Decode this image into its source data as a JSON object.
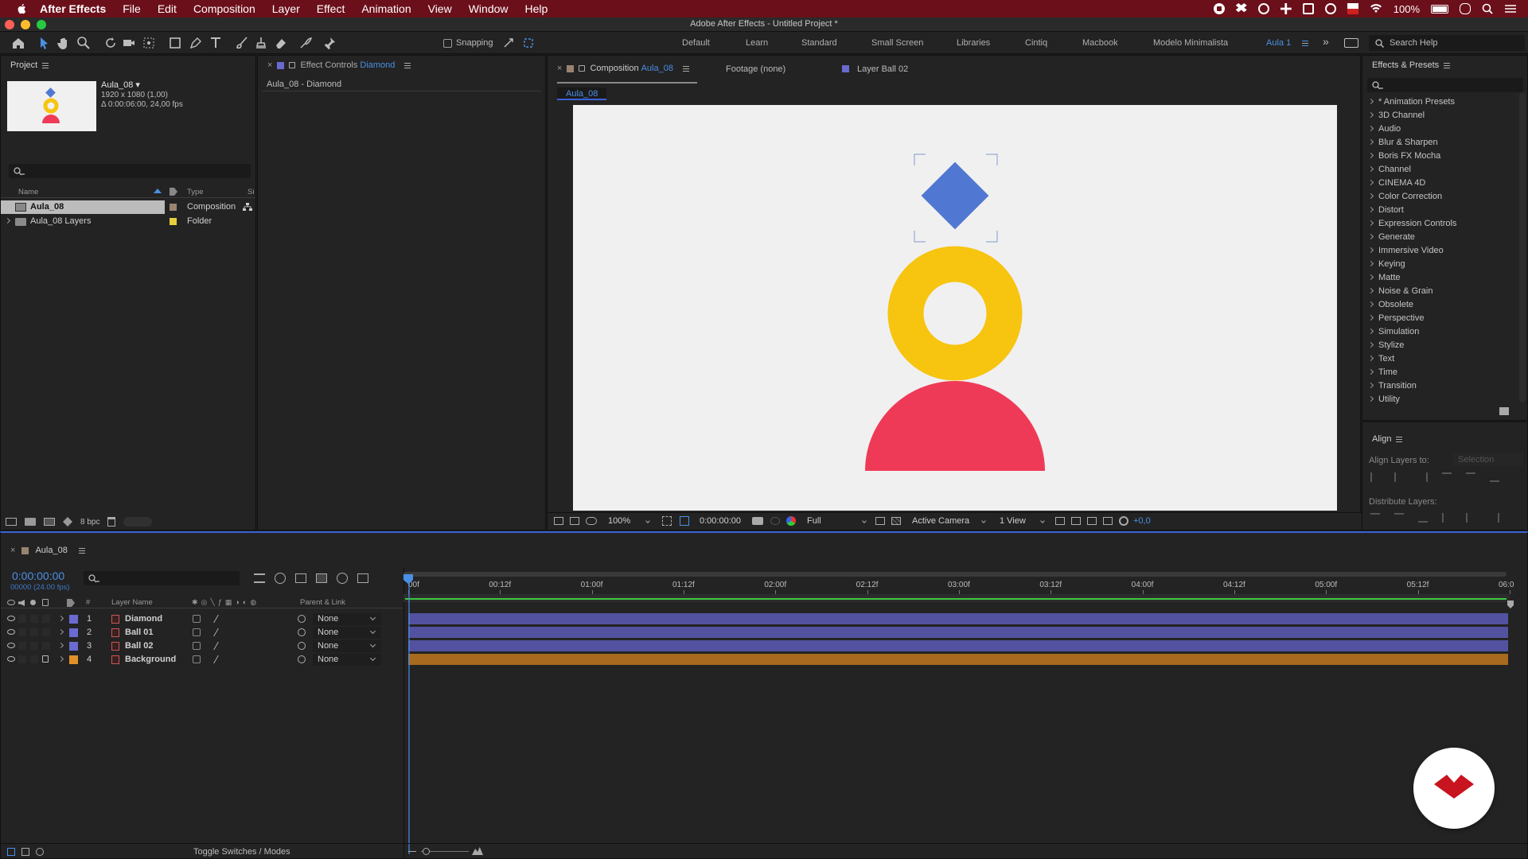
{
  "menubar": {
    "app_name": "After Effects",
    "items": [
      "File",
      "Edit",
      "Composition",
      "Layer",
      "Effect",
      "Animation",
      "View",
      "Window",
      "Help"
    ],
    "battery": "100%"
  },
  "window": {
    "title": "Adobe After Effects - Untitled Project *"
  },
  "toolbar": {
    "snapping_label": "Snapping",
    "workspaces": [
      "Default",
      "Learn",
      "Standard",
      "Small Screen",
      "Libraries",
      "Cintiq",
      "Macbook",
      "Modelo Minimalista",
      "Aula 1"
    ],
    "active_workspace": "Aula 1",
    "search_placeholder": "Search Help"
  },
  "project": {
    "tab": "Project",
    "selected_name": "Aula_08 ▾",
    "selected_dims": "1920 x 1080 (1,00)",
    "selected_duration": "Δ 0:00:06:00, 24,00 fps",
    "columns": [
      "Name",
      "Type",
      "Si"
    ],
    "items": [
      {
        "name": "Aula_08",
        "type": "Composition",
        "label_color": "#9a8470"
      },
      {
        "name": "Aula_08 Layers",
        "type": "Folder",
        "label_color": "#e6cf3c"
      }
    ],
    "bpc": "8 bpc"
  },
  "effect_controls": {
    "tab_prefix": "Effect Controls",
    "tab_layer": "Diamond",
    "subtitle": "Aula_08 - Diamond"
  },
  "composition": {
    "tab_prefix": "Composition",
    "tab_name": "Aula_08",
    "footage_tab": "Footage (none)",
    "layer_tab": "Layer Ball 02",
    "subtab": "Aula_08",
    "footer": {
      "zoom": "100%",
      "timecode": "0:00:00:00",
      "resolution": "Full",
      "camera": "Active Camera",
      "view": "1 View",
      "exposure": "+0,0"
    },
    "colors": {
      "diamond": "#5078d2",
      "ring": "#f7c40f",
      "semicircle": "#ef3a57",
      "bg": "#f0f0f0"
    }
  },
  "effects": {
    "tab": "Effects & Presets",
    "categories": [
      "* Animation Presets",
      "3D Channel",
      "Audio",
      "Blur & Sharpen",
      "Boris FX Mocha",
      "Channel",
      "CINEMA 4D",
      "Color Correction",
      "Distort",
      "Expression Controls",
      "Generate",
      "Immersive Video",
      "Keying",
      "Matte",
      "Noise & Grain",
      "Obsolete",
      "Perspective",
      "Simulation",
      "Stylize",
      "Text",
      "Time",
      "Transition",
      "Utility"
    ]
  },
  "align": {
    "tab": "Align",
    "align_to_label": "Align Layers to:",
    "align_to_value": "Selection",
    "distribute_label": "Distribute Layers:"
  },
  "timeline": {
    "tab": "Aula_08",
    "timecode": "0:00:00:00",
    "frames": "00000 (24.00 fps)",
    "columns": {
      "number": "#",
      "layer_name": "Layer Name",
      "parent": "Parent & Link"
    },
    "ticks": [
      "00f",
      "00:12f",
      "01:00f",
      "01:12f",
      "02:00f",
      "02:12f",
      "03:00f",
      "03:12f",
      "04:00f",
      "04:12f",
      "05:00f",
      "05:12f",
      "06:0"
    ],
    "layers": [
      {
        "num": "1",
        "name": "Diamond",
        "label": "#6a6ad0",
        "parent": "None",
        "bar": "#5252a0",
        "locked": false
      },
      {
        "num": "2",
        "name": "Ball 01",
        "label": "#6a6ad0",
        "parent": "None",
        "bar": "#5252a0",
        "locked": false
      },
      {
        "num": "3",
        "name": "Ball 02",
        "label": "#6a6ad0",
        "parent": "None",
        "bar": "#5252a0",
        "locked": false
      },
      {
        "num": "4",
        "name": "Background",
        "label": "#e0902a",
        "parent": "None",
        "bar": "#a86a1e",
        "locked": true
      }
    ],
    "footer_label": "Toggle Switches / Modes"
  }
}
